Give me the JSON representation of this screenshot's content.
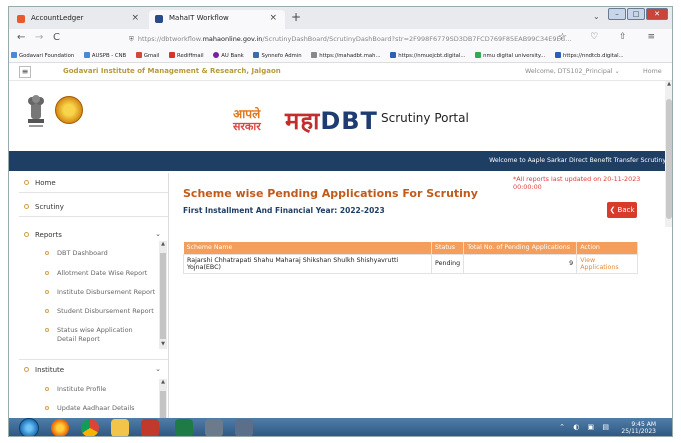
{
  "browser": {
    "tabs": [
      {
        "title": "AccountLedger",
        "close": "×",
        "favicon_color": "#e8592c"
      },
      {
        "title": "MahaIT Workflow",
        "close": "×",
        "favicon_color": "#2b4a8a"
      }
    ],
    "new_tab": "+",
    "tab_dropdown": "⌄",
    "window_buttons": [
      "–",
      "□",
      "✕"
    ],
    "nav": {
      "back": "←",
      "forward": "→",
      "reload": "C"
    },
    "url": {
      "prefix": "https://dbtworkflow.",
      "domain": "mahaonline.gov.in",
      "path": "/ScrutinyDashBoard/ScrutinyDashBoard?str=2F998F6779SD3DB7FCD769F85EAB99C34E9EC",
      "ellipsis": "…"
    },
    "star": "☆",
    "right_icons": "♡ ⇧ ≡",
    "bookmarks": [
      {
        "label": "Godavari Foundation",
        "color": "#4a8ad4"
      },
      {
        "label": "AUSPB - CNB",
        "color": "#4a8ad4"
      },
      {
        "label": "Gmail",
        "color": "#d44638"
      },
      {
        "label": "Rediffmail",
        "color": "#d6332a"
      },
      {
        "label": "AU Bank",
        "color": "#7b1fa2"
      },
      {
        "label": "Synnefo Admin",
        "color": "#3b6ea8"
      },
      {
        "label": "https://mahadbt.mah...",
        "color": "#888888"
      },
      {
        "label": "https://nmuejcbt.digital...",
        "color": "#2b5fb8"
      },
      {
        "label": "nmu digital university...",
        "color": "#34a853"
      },
      {
        "label": "https://nndtcb.digital...",
        "color": "#2b5fb8"
      }
    ]
  },
  "site": {
    "hamburger": "≡",
    "institute_title": "Godavari Institute of Management & Research, Jalgaon",
    "welcome": "Welcome, DTS102_Principal ⌄",
    "home_link": "Home",
    "logo_line1": "आपले",
    "logo_line2": "सरकार",
    "brand_maha": "महा",
    "brand_dbt": "DBT",
    "portal_title": "Scrutiny Portal",
    "banner_message": "Welcome to Aaple Sarkar Direct Benefit Transfer Scrutiny"
  },
  "sidebar": {
    "items": [
      {
        "label": "Home",
        "chevron": ""
      },
      {
        "label": "Scrutiny",
        "chevron": ""
      },
      {
        "label": "Reports",
        "chevron": "⌄"
      }
    ],
    "report_subitems": [
      "DBT Dashboard",
      "Allotment Date Wise Report",
      "Institute Disbursement Report",
      "Student Disbursement Report",
      "Status wise Application Detail Report"
    ],
    "institute": {
      "label": "Institute",
      "chevron": "⌄"
    },
    "institute_subitems": [
      "Institute Profile",
      "Update Aadhaar Details"
    ],
    "scroll_up": "▲",
    "scroll_down": "▼"
  },
  "main": {
    "title": "Scheme wise Pending Applications For Scrutiny",
    "subtitle": "First Installment And Financial Year: 2022-2023",
    "notice": "*All reports last updated on 20-11-2023 00:00:00",
    "back_label": "❮ Back",
    "table": {
      "headers": [
        "Scheme Name",
        "Status",
        "Total No. of Pending Applications",
        "Action"
      ],
      "rows": [
        {
          "scheme": "Rajarshi Chhatrapati Shahu Maharaj Shikshan Shulkh Shishyavrutti Yojna(EBC)",
          "status": "Pending",
          "count": "9",
          "action": "View Applications"
        }
      ]
    }
  },
  "taskbar": {
    "apps": [
      {
        "name": "start",
        "color": "#1d6fb7"
      },
      {
        "name": "firefox",
        "color": "#e66000"
      },
      {
        "name": "chrome",
        "color": "#4285f4"
      },
      {
        "name": "explorer",
        "color": "#f3c44a"
      },
      {
        "name": "paint",
        "color": "#c0392b"
      },
      {
        "name": "excel",
        "color": "#1e7b45"
      },
      {
        "name": "calculator",
        "color": "#6b7b8c"
      },
      {
        "name": "notepad",
        "color": "#5c6f8a"
      }
    ],
    "tray_icons": "⌃ ◐ ▣ ▤",
    "time": "9:45 AM",
    "date": "25/11/2023"
  }
}
